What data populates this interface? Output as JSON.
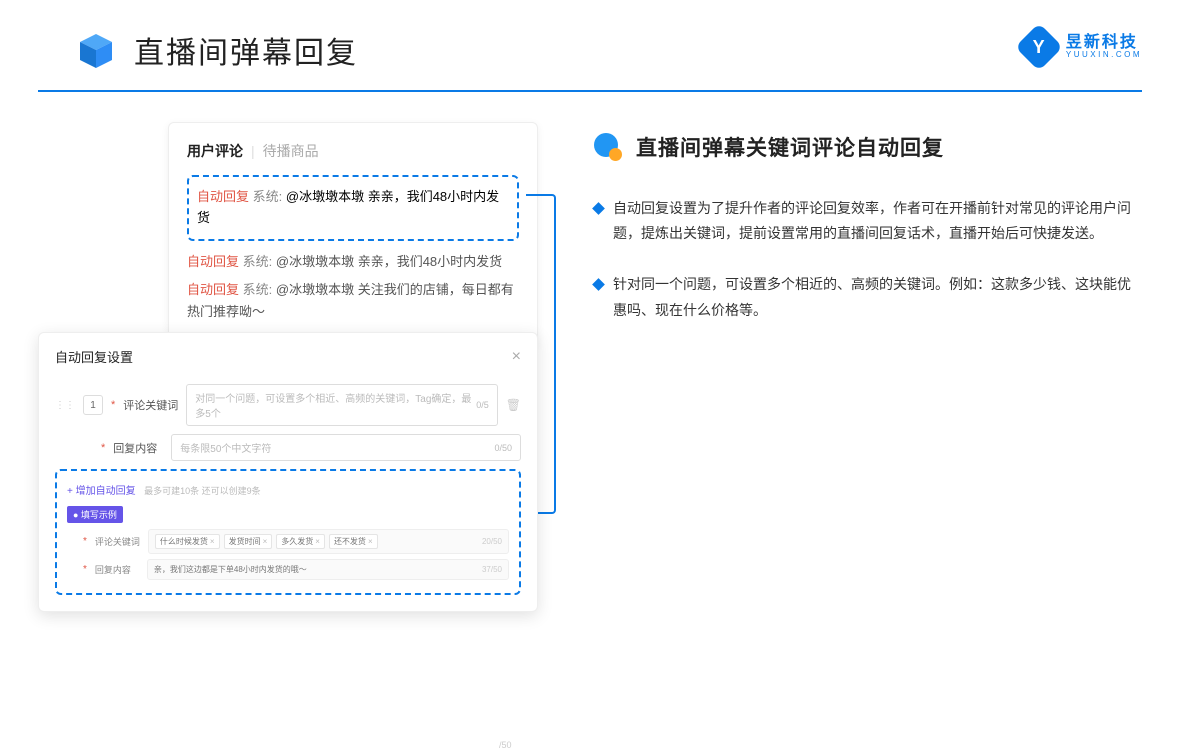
{
  "page_title": "直播间弹幕回复",
  "brand": {
    "cn": "昱新科技",
    "en": "YUUXIN.COM"
  },
  "card1": {
    "tab_active": "用户评论",
    "tab_other": "待播商品",
    "highlight_auto": "自动回复",
    "highlight_sys": "系统:",
    "highlight_text": "@冰墩墩本墩 亲亲，我们48小时内发货",
    "line2_text": "@冰墩墩本墩 亲亲，我们48小时内发货",
    "line3_text": "@冰墩墩本墩 关注我们的店铺，每日都有热门推荐呦～"
  },
  "card2": {
    "title": "自动回复设置",
    "idx": "1",
    "label_keyword": "评论关键词",
    "ph_keyword": "对同一个问题，可设置多个相近、高频的关键词，Tag确定，最多5个",
    "count_keyword": "0/5",
    "label_content": "回复内容",
    "ph_content": "每条限50个中文字符",
    "count_content": "0/50",
    "add_link": "+ 增加自动回复",
    "add_hint": "最多可建10条 还可以创建9条",
    "badge": "● 填写示例",
    "ex_kw_label": "评论关键词",
    "ex_tags": [
      "什么时候发货",
      "发货时间",
      "多久发货",
      "还不发货"
    ],
    "ex_kw_count": "20/50",
    "ex_content_label": "回复内容",
    "ex_content_text": "亲，我们这边都是下单48小时内发货的哦～",
    "ex_content_count": "37/50",
    "floor_count": "/50"
  },
  "right": {
    "section_title": "直播间弹幕关键词评论自动回复",
    "bullet1": "自动回复设置为了提升作者的评论回复效率，作者可在开播前针对常见的评论用户问题，提炼出关键词，提前设置常用的直播间回复话术，直播开始后可快捷发送。",
    "bullet2": "针对同一个问题，可设置多个相近的、高频的关键词。例如：这款多少钱、这块能优惠吗、现在什么价格等。"
  }
}
